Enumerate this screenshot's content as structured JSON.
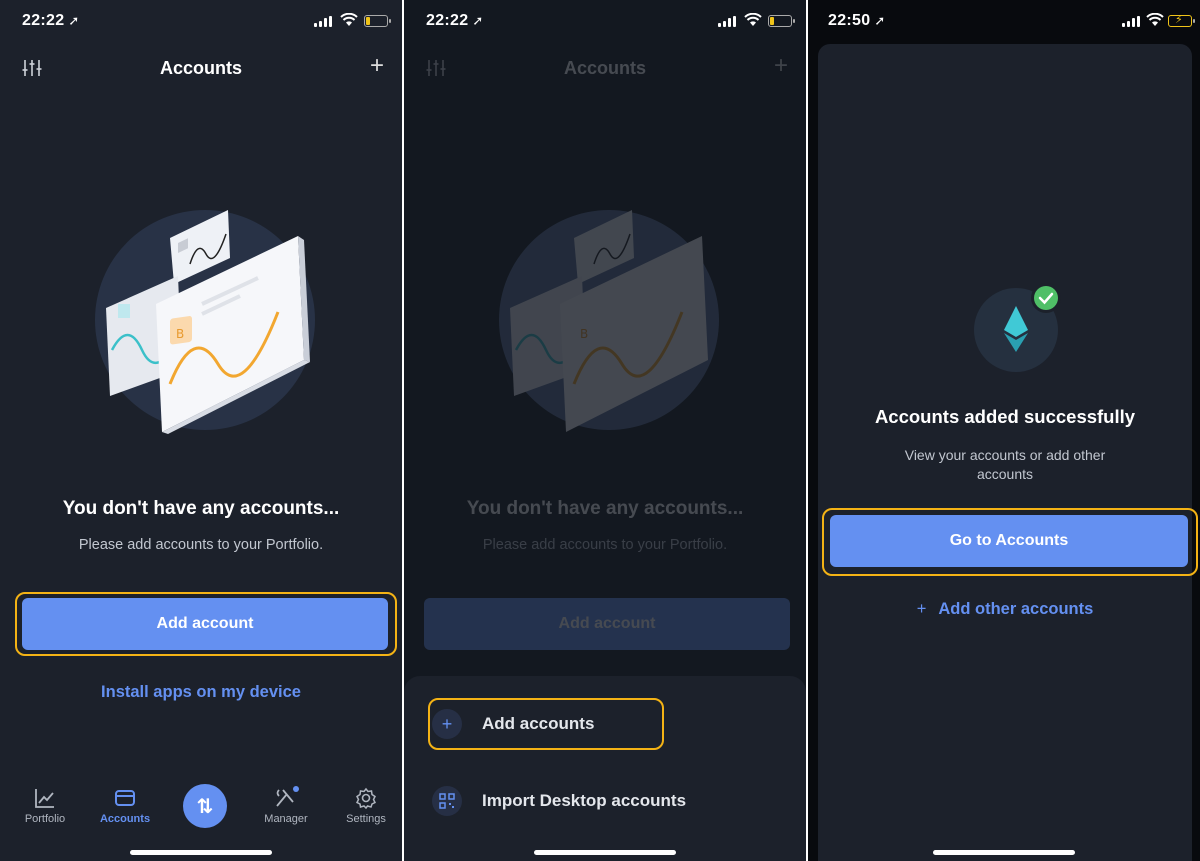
{
  "screen1": {
    "status": {
      "time": "22:22"
    },
    "header": {
      "title": "Accounts"
    },
    "empty": {
      "title": "You don't have any accounts...",
      "subtitle": "Please add accounts to your Portfolio."
    },
    "add_button": "Add account",
    "install_link": "Install apps on my device",
    "tabs": [
      {
        "label": "Portfolio",
        "icon": "chart-icon"
      },
      {
        "label": "Accounts",
        "icon": "wallet-icon",
        "active": true
      },
      {
        "label": "",
        "icon": "transfer-icon"
      },
      {
        "label": "Manager",
        "icon": "tools-icon"
      },
      {
        "label": "Settings",
        "icon": "gear-icon"
      }
    ]
  },
  "screen2": {
    "status": {
      "time": "22:22"
    },
    "header": {
      "title": "Accounts"
    },
    "empty": {
      "title": "You don't have any accounts...",
      "subtitle": "Please add accounts to your Portfolio."
    },
    "add_button": "Add account",
    "sheet": {
      "items": [
        {
          "label": "Add accounts",
          "icon": "plus-icon"
        },
        {
          "label": "Import Desktop accounts",
          "icon": "qr-code-icon"
        }
      ]
    }
  },
  "screen3": {
    "status": {
      "time": "22:50"
    },
    "success": {
      "title": "Accounts added successfully",
      "subtitle": "View your accounts or add other accounts"
    },
    "primary_button": "Go to Accounts",
    "secondary_link": "Add other accounts",
    "secondary_icon": "+"
  },
  "colors": {
    "accent": "#6490f1",
    "highlight": "#f4b315",
    "background": "#1c212b",
    "success": "#4fbf67"
  }
}
